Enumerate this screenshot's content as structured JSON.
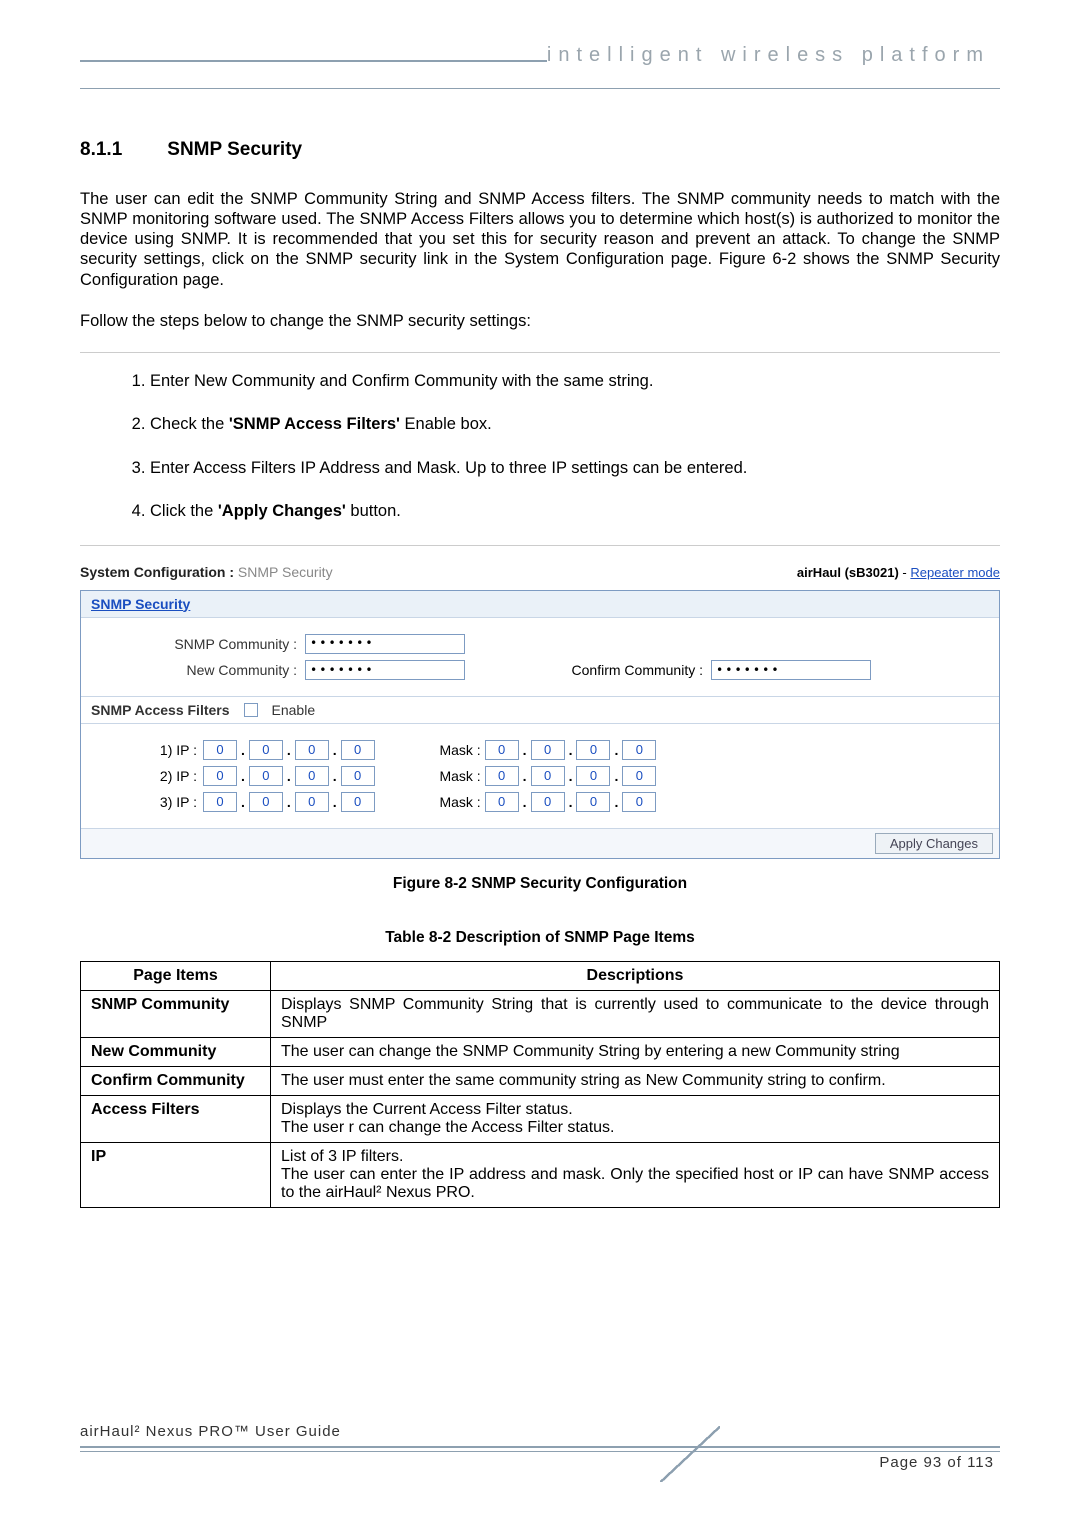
{
  "header": {
    "tagline": "intelligent wireless platform"
  },
  "section": {
    "number": "8.1.1",
    "title": "SNMP Security"
  },
  "para1": "The user can edit the SNMP Community String and SNMP Access filters. The SNMP community needs to match with the SNMP monitoring software used. The SNMP Access Filters allows you to determine which host(s) is authorized to monitor the device using SNMP. It is recommended that you set this for security reason and prevent an attack. To change the SNMP security settings, click on the SNMP security link in the System Configuration page.  Figure 6-2 shows the SNMP Security Configuration page.",
  "para2": "Follow the steps below to change the SNMP security settings:",
  "steps": {
    "s1": "Enter New Community and Confirm Community with the same string.",
    "s2_pre": "Check the ",
    "s2_bold": "'SNMP Access Filters'",
    "s2_post": " Enable box.",
    "s3": "Enter Access Filters IP Address and Mask. Up to three IP settings can be entered.",
    "s4_pre": "Click the ",
    "s4_bold": "'Apply Changes'",
    "s4_post": " button."
  },
  "shot": {
    "title_bold": "System Configuration :",
    "title_grey": "SNMP Security",
    "device": "airHaul (sB3021)",
    "mode_link": "Repeater mode",
    "panel_head": "SNMP Security",
    "snmp_comm_lbl": "SNMP Community :",
    "new_comm_lbl": "New Community :",
    "confirm_comm_lbl": "Confirm Community :",
    "masked": "•••••••",
    "filters_head": "SNMP Access Filters",
    "enable": "Enable",
    "ip1": "1) IP :",
    "ip2": "2) IP :",
    "ip3": "3) IP :",
    "mask": "Mask :",
    "oct": "0",
    "apply": "Apply Changes"
  },
  "fig_caption": "Figure 8-2 SNMP Security Configuration",
  "tbl_caption": "Table 8-2 Description of SNMP Page Items",
  "table": {
    "h1": "Page Items",
    "h2": "Descriptions",
    "rows": [
      {
        "k": "SNMP Community",
        "v": "Displays SNMP Community String that is currently used to communicate to the device through SNMP"
      },
      {
        "k": "New  Community",
        "v": "The user  can change the SNMP Community String by entering a new Community string"
      },
      {
        "k": "Confirm Community",
        "v": "The user  must enter the same community string as New Community string to confirm."
      },
      {
        "k": "Access Filters",
        "v": "Displays the Current Access Filter status.\nThe user r can change the Access Filter status."
      },
      {
        "k": "IP",
        "v": "List of 3 IP filters.\nThe user  can enter the IP address and mask. Only the specified host or IP can have SNMP access to the airHaul² Nexus PRO."
      }
    ]
  },
  "footer": {
    "left": "airHaul² Nexus PRO™ User Guide",
    "page": "Page 93 of 113"
  }
}
